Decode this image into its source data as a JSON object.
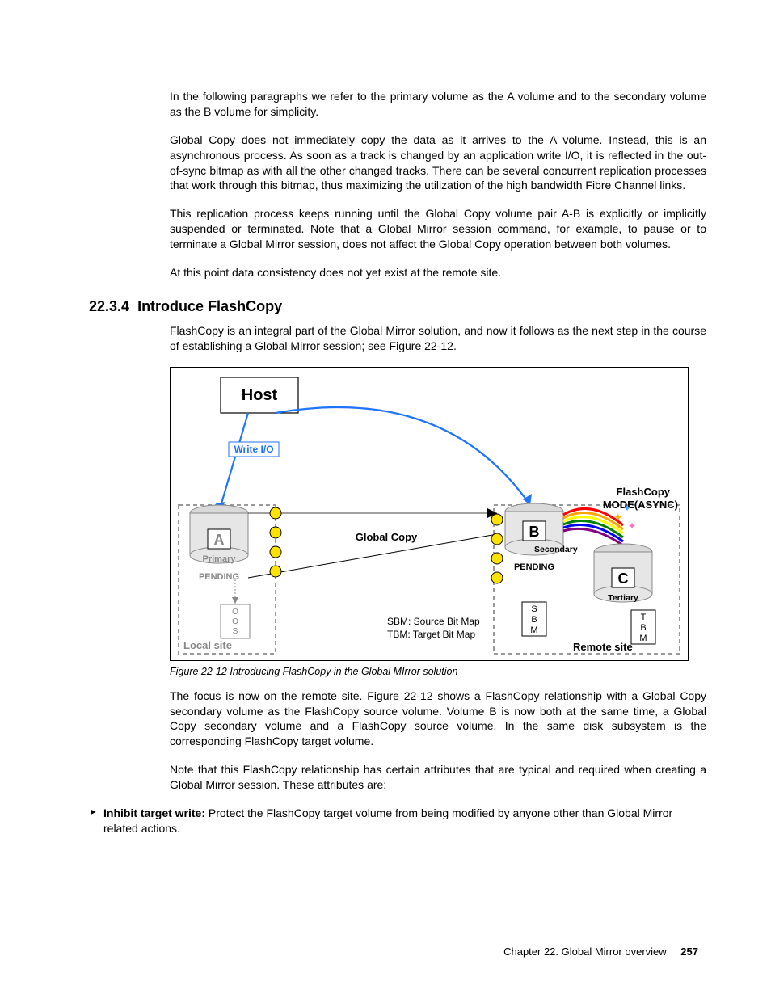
{
  "paragraphs": {
    "p1": "In the following paragraphs we refer to the primary volume as the A volume and to the secondary volume as the B volume for simplicity.",
    "p2": "Global Copy does not immediately copy the data as it arrives to the A volume. Instead, this is an asynchronous process. As soon as a track is changed by an application write I/O, it is reflected in the out-of-sync bitmap as with all the other changed tracks. There can be several concurrent replication processes that work through this bitmap, thus maximizing the utilization of the high bandwidth Fibre Channel links.",
    "p3": "This replication process keeps running until the Global Copy volume pair A-B is explicitly or implicitly suspended or terminated. Note that a Global Mirror session command, for example, to pause or to terminate a Global Mirror session, does not affect the Global Copy operation between both volumes.",
    "p4": "At this point data consistency does not yet exist at the remote site."
  },
  "section": {
    "number": "22.3.4",
    "title": "Introduce FlashCopy"
  },
  "section_paragraphs": {
    "s1": "FlashCopy is an integral part of the Global Mirror solution, and now it follows as the next step in the course of establishing a Global Mirror session; see Figure 22-12.",
    "s2": "The focus is now on the remote site. Figure 22-12 shows a FlashCopy relationship with a Global Copy secondary volume as the FlashCopy source volume. Volume B is now both at the same time, a Global Copy secondary volume and a FlashCopy source volume. In the same disk subsystem is the corresponding FlashCopy target volume.",
    "s3": "Note that this FlashCopy relationship has certain attributes that are typical and required when creating a Global Mirror session. These attributes are:"
  },
  "bullet": {
    "b1_label": "Inhibit target write:",
    "b1_rest": " Protect the FlashCopy target volume from being modified by anyone other than Global Mirror related actions."
  },
  "figure": {
    "caption": "Figure 22-12   Introducing FlashCopy in the Global MIrror solution",
    "host": "Host",
    "writeio": "Write I/O",
    "a": "A",
    "primary": "Primary",
    "pending_a": "PENDING",
    "oos": "OOS",
    "local_site": "Local site",
    "global_copy": "Global Copy",
    "sbm_line": "SBM: Source Bit Map",
    "tbm_line": "TBM: Target Bit Map",
    "b": "B",
    "secondary": "Secondary",
    "pending_b": "PENDING",
    "sbm": "SBM",
    "remote_site": "Remote site",
    "flashcopy1": "FlashCopy",
    "flashcopy2": "MODE(ASYNC)",
    "c": "C",
    "tertiary": "Tertiary",
    "tbm": "TBM"
  },
  "footer": {
    "chapter": "Chapter 22. Global Mirror overview",
    "page": "257"
  }
}
